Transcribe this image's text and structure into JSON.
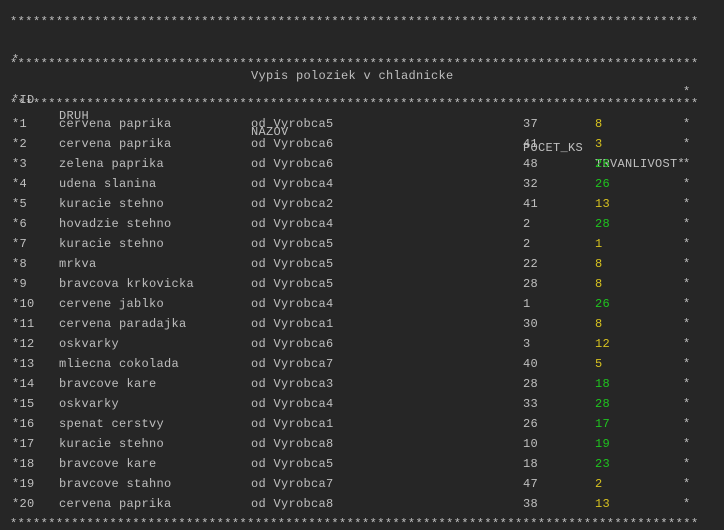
{
  "console": {
    "separator": "******************************************************************************************",
    "title_prefix": "*",
    "title": "Vypis poloziek v chladnicke",
    "title_suffix": "*",
    "headers": {
      "id": "*ID",
      "druh": "DRUH",
      "nazov": "NAZOV",
      "pocet": "POCET_KS",
      "trvanlivost": "TRVANLIVOST*"
    },
    "row_end": "*",
    "colors": {
      "green": "#1fc41f",
      "yellow": "#d7c21f",
      "text": "#bfbfbf",
      "background": "#262626"
    },
    "rows": [
      {
        "id": "*1",
        "druh": "cervena paprika",
        "nazov": "od Vyrobca5",
        "pocet": "37",
        "trv": "8",
        "color": "yellow"
      },
      {
        "id": "*2",
        "druh": "cervena paprika",
        "nazov": "od Vyrobca6",
        "pocet": "41",
        "trv": "3",
        "color": "yellow"
      },
      {
        "id": "*3",
        "druh": "zelena paprika",
        "nazov": "od Vyrobca6",
        "pocet": "48",
        "trv": "26",
        "color": "green"
      },
      {
        "id": "*4",
        "druh": "udena slanina",
        "nazov": "od Vyrobca4",
        "pocet": "32",
        "trv": "26",
        "color": "green"
      },
      {
        "id": "*5",
        "druh": "kuracie stehno",
        "nazov": "od Vyrobca2",
        "pocet": "41",
        "trv": "13",
        "color": "yellow"
      },
      {
        "id": "*6",
        "druh": "hovadzie stehno",
        "nazov": "od Vyrobca4",
        "pocet": "2",
        "trv": "28",
        "color": "green"
      },
      {
        "id": "*7",
        "druh": "kuracie stehno",
        "nazov": "od Vyrobca5",
        "pocet": "2",
        "trv": "1",
        "color": "yellow"
      },
      {
        "id": "*8",
        "druh": "mrkva",
        "nazov": "od Vyrobca5",
        "pocet": "22",
        "trv": "8",
        "color": "yellow"
      },
      {
        "id": "*9",
        "druh": "bravcova krkovicka",
        "nazov": "od Vyrobca5",
        "pocet": "28",
        "trv": "8",
        "color": "yellow"
      },
      {
        "id": "*10",
        "druh": "cervene jablko",
        "nazov": "od Vyrobca4",
        "pocet": "1",
        "trv": "26",
        "color": "green"
      },
      {
        "id": "*11",
        "druh": "cervena paradajka",
        "nazov": "od Vyrobca1",
        "pocet": "30",
        "trv": "8",
        "color": "yellow"
      },
      {
        "id": "*12",
        "druh": "oskvarky",
        "nazov": "od Vyrobca6",
        "pocet": "3",
        "trv": "12",
        "color": "yellow"
      },
      {
        "id": "*13",
        "druh": "mliecna cokolada",
        "nazov": "od Vyrobca7",
        "pocet": "40",
        "trv": "5",
        "color": "yellow"
      },
      {
        "id": "*14",
        "druh": "bravcove kare",
        "nazov": "od Vyrobca3",
        "pocet": "28",
        "trv": "18",
        "color": "green"
      },
      {
        "id": "*15",
        "druh": "oskvarky",
        "nazov": "od Vyrobca4",
        "pocet": "33",
        "trv": "28",
        "color": "green"
      },
      {
        "id": "*16",
        "druh": "spenat cerstvy",
        "nazov": "od Vyrobca1",
        "pocet": "26",
        "trv": "17",
        "color": "green"
      },
      {
        "id": "*17",
        "druh": "kuracie stehno",
        "nazov": "od Vyrobca8",
        "pocet": "10",
        "trv": "19",
        "color": "green"
      },
      {
        "id": "*18",
        "druh": "bravcove kare",
        "nazov": "od Vyrobca5",
        "pocet": "18",
        "trv": "23",
        "color": "green"
      },
      {
        "id": "*19",
        "druh": "bravcove stahno",
        "nazov": "od Vyrobca7",
        "pocet": "47",
        "trv": "2",
        "color": "yellow"
      },
      {
        "id": "*20",
        "druh": "cervena paprika",
        "nazov": "od Vyrobca8",
        "pocet": "38",
        "trv": "13",
        "color": "yellow"
      }
    ]
  }
}
